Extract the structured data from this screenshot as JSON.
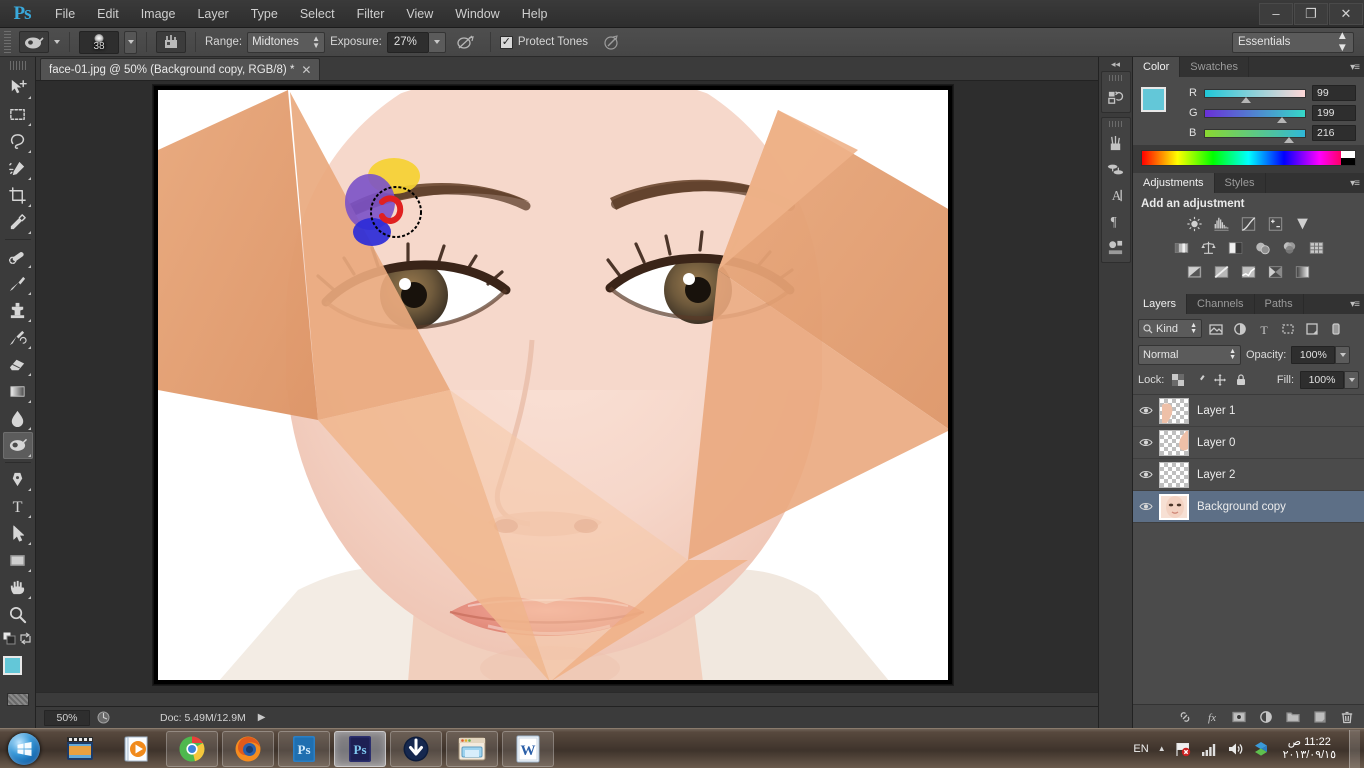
{
  "app": {
    "logo": "Ps"
  },
  "menubar": {
    "items": [
      "File",
      "Edit",
      "Image",
      "Layer",
      "Type",
      "Select",
      "Filter",
      "View",
      "Window",
      "Help"
    ]
  },
  "window_controls": {
    "minimize": "–",
    "restore": "❐",
    "close": "✕"
  },
  "options_bar": {
    "brush_size": "38",
    "range_label": "Range:",
    "range_value": "Midtones",
    "exposure_label": "Exposure:",
    "exposure_value": "27%",
    "protect_tones_label": "Protect Tones",
    "protect_tones_checked": true,
    "check_glyph": "✓",
    "workspace": "Essentials"
  },
  "toolbox": {
    "tools": [
      {
        "name": "move-tool",
        "label": "Move Tool"
      },
      {
        "name": "rectangular-marquee-tool",
        "label": "Rectangular Marquee Tool"
      },
      {
        "name": "lasso-tool",
        "label": "Lasso Tool"
      },
      {
        "name": "quick-selection-tool",
        "label": "Quick Selection Tool"
      },
      {
        "name": "crop-tool",
        "label": "Crop Tool"
      },
      {
        "name": "eyedropper-tool",
        "label": "Eyedropper Tool"
      },
      {
        "name": "spot-healing-brush-tool",
        "label": "Spot Healing Brush Tool"
      },
      {
        "name": "brush-tool",
        "label": "Brush Tool"
      },
      {
        "name": "clone-stamp-tool",
        "label": "Clone Stamp Tool"
      },
      {
        "name": "history-brush-tool",
        "label": "History Brush Tool"
      },
      {
        "name": "eraser-tool",
        "label": "Eraser Tool"
      },
      {
        "name": "gradient-tool",
        "label": "Gradient Tool"
      },
      {
        "name": "blur-tool",
        "label": "Blur Tool"
      },
      {
        "name": "dodge-tool",
        "label": "Dodge Tool"
      },
      {
        "name": "pen-tool",
        "label": "Pen Tool"
      },
      {
        "name": "horizontal-type-tool",
        "label": "Horizontal Type Tool"
      },
      {
        "name": "path-selection-tool",
        "label": "Path Selection Tool"
      },
      {
        "name": "rectangle-tool",
        "label": "Rectangle Tool"
      },
      {
        "name": "hand-tool",
        "label": "Hand Tool"
      },
      {
        "name": "zoom-tool",
        "label": "Zoom Tool"
      }
    ],
    "active_tool": "dodge-tool",
    "foreground_color": "#63c7d8",
    "background_color": "#000000"
  },
  "document": {
    "tab_title": "face-01.jpg @ 50% (Background copy, RGB/8) *",
    "close_glyph": "✕"
  },
  "status_bar": {
    "zoom": "50%",
    "doc_info": "Doc: 5.49M/12.9M",
    "arrow_glyph": "▶"
  },
  "mini_dock": {
    "collapse_glyph": "◂◂",
    "icons": [
      {
        "name": "history-panel-icon",
        "label": "History"
      },
      {
        "name": "brush-panel-icon",
        "label": "Brush"
      },
      {
        "name": "clone-source-panel-icon",
        "label": "Clone Source"
      },
      {
        "name": "character-panel-icon",
        "label": "Character"
      },
      {
        "name": "paragraph-panel-icon",
        "label": "Paragraph"
      },
      {
        "name": "mini-bridge-panel-icon",
        "label": "Mini Bridge"
      }
    ]
  },
  "color_panel": {
    "tabs": [
      "Color",
      "Swatches"
    ],
    "active_tab": "Color",
    "menu_glyph": "▾≡",
    "channels": [
      {
        "label": "R",
        "value": "99",
        "pos": 43
      },
      {
        "label": "G",
        "value": "199",
        "pos": 77
      },
      {
        "label": "B",
        "value": "216",
        "pos": 83
      }
    ],
    "foreground_color": "#63c7d8",
    "background_color": "#000000"
  },
  "adjustments_panel": {
    "tabs": [
      "Adjustments",
      "Styles"
    ],
    "active_tab": "Adjustments",
    "heading": "Add an adjustment",
    "menu_glyph": "▾≡",
    "rows": [
      [
        {
          "name": "brightness-contrast-icon"
        },
        {
          "name": "levels-icon"
        },
        {
          "name": "curves-icon"
        },
        {
          "name": "exposure-icon"
        },
        {
          "name": "vibrance-icon"
        }
      ],
      [
        {
          "name": "hue-saturation-icon"
        },
        {
          "name": "color-balance-icon"
        },
        {
          "name": "black-and-white-icon"
        },
        {
          "name": "photo-filter-icon"
        },
        {
          "name": "channel-mixer-icon"
        },
        {
          "name": "color-lookup-icon"
        }
      ],
      [
        {
          "name": "invert-icon"
        },
        {
          "name": "posterize-icon"
        },
        {
          "name": "threshold-icon"
        },
        {
          "name": "selective-color-icon"
        },
        {
          "name": "gradient-map-icon"
        }
      ]
    ]
  },
  "layers_panel": {
    "tabs": [
      "Layers",
      "Channels",
      "Paths"
    ],
    "active_tab": "Layers",
    "menu_glyph": "▾≡",
    "filter": {
      "label": "Kind",
      "search_icon": "search-icon"
    },
    "filter_icons": [
      {
        "name": "filter-pixel-icon"
      },
      {
        "name": "filter-adjustment-icon"
      },
      {
        "name": "filter-type-icon"
      },
      {
        "name": "filter-shape-icon"
      },
      {
        "name": "filter-smart-object-icon"
      },
      {
        "name": "filter-toggle-icon"
      }
    ],
    "blend_mode": "Normal",
    "opacity_label": "Opacity:",
    "opacity_value": "100%",
    "lock_label": "Lock:",
    "lock_icons": [
      {
        "name": "lock-transparent-pixels-icon"
      },
      {
        "name": "lock-image-pixels-icon"
      },
      {
        "name": "lock-position-icon"
      },
      {
        "name": "lock-all-icon"
      }
    ],
    "fill_label": "Fill:",
    "fill_value": "100%",
    "layers": [
      {
        "name": "Layer 1",
        "visible": true,
        "selected": false,
        "thumb": "transparent-with-skin"
      },
      {
        "name": "Layer 0",
        "visible": true,
        "selected": false,
        "thumb": "transparent-with-skin"
      },
      {
        "name": "Layer 2",
        "visible": true,
        "selected": false,
        "thumb": "transparent"
      },
      {
        "name": "Background copy",
        "visible": true,
        "selected": true,
        "thumb": "face-photo"
      }
    ],
    "footer_icons": [
      {
        "name": "link-layers-icon"
      },
      {
        "name": "layer-style-fx-icon"
      },
      {
        "name": "add-layer-mask-icon"
      },
      {
        "name": "new-adjustment-layer-icon"
      },
      {
        "name": "new-group-icon"
      },
      {
        "name": "new-layer-icon"
      },
      {
        "name": "delete-layer-icon"
      }
    ]
  },
  "taskbar": {
    "start_label": "Start",
    "apps": [
      {
        "name": "taskbar-movie-maker",
        "label": "Movie Maker",
        "state": "pinned"
      },
      {
        "name": "taskbar-media-player",
        "label": "Windows Media Player",
        "state": "pinned"
      },
      {
        "name": "taskbar-chrome",
        "label": "Google Chrome",
        "state": "open"
      },
      {
        "name": "taskbar-firefox",
        "label": "Mozilla Firefox",
        "state": "open"
      },
      {
        "name": "taskbar-photoshop-cs5",
        "label": "Adobe Photoshop",
        "state": "open"
      },
      {
        "name": "taskbar-photoshop-cs6",
        "label": "Adobe Photoshop CS6",
        "state": "active"
      },
      {
        "name": "taskbar-download-manager",
        "label": "Download Manager",
        "state": "open"
      },
      {
        "name": "taskbar-explorer",
        "label": "Windows Explorer",
        "state": "open"
      },
      {
        "name": "taskbar-word",
        "label": "Microsoft Word",
        "state": "open"
      }
    ],
    "tray": {
      "language": "EN",
      "show_hidden_glyph": "▲",
      "icons": [
        {
          "name": "security-flag-icon"
        },
        {
          "name": "network-signal-icon"
        },
        {
          "name": "volume-icon"
        },
        {
          "name": "dropbox-icon"
        }
      ],
      "time": "11:22 ص",
      "date": "٢٠١٣/٠٩/١٥"
    }
  }
}
